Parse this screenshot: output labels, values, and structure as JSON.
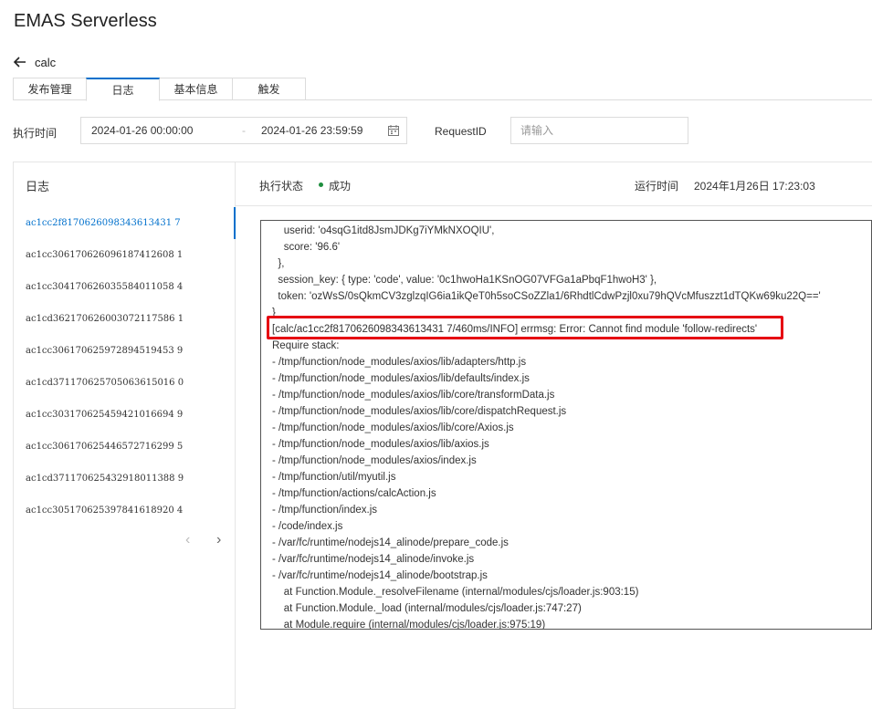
{
  "app": {
    "title": "EMAS Serverless"
  },
  "function": {
    "name": "calc"
  },
  "tabs": [
    {
      "label": "发布管理"
    },
    {
      "label": "日志",
      "active": true
    },
    {
      "label": "基本信息"
    },
    {
      "label": "触发"
    }
  ],
  "filters": {
    "time_label": "执行时间",
    "start": "2024-01-26 00:00:00",
    "separator": "-",
    "end": "2024-01-26 23:59:59",
    "request_label": "RequestID",
    "request_placeholder": "请输入"
  },
  "log_panel": {
    "title": "日志",
    "items": [
      "ac1cc2f8170626098343613431 7",
      "ac1cc306170626096187412608 1",
      "ac1cc304170626035584011058 4",
      "ac1cd362170626003072117586 1",
      "ac1cc306170625972894519453 9",
      "ac1cd371170625705063615016 0",
      "ac1cc303170625459421016694 9",
      "ac1cc306170625446572716299 5",
      "ac1cd371170625432918011388 9",
      "ac1cc305170625397841618920 4"
    ],
    "prev": "‹",
    "next": "›"
  },
  "detail": {
    "status_label": "执行状态",
    "status_value": "成功",
    "run_time_label": "运行时间",
    "run_time_value": "2024年1月26日 17:23:03",
    "status_color": "#1e8e3e",
    "lines": [
      "    userid: 'o4sqG1itd8JsmJDKg7iYMkNXOQIU',",
      "    score: '96.6'",
      "  },",
      "  session_key: { type: 'code', value: '0c1hwoHa1KSnOG07VFGa1aPbqF1hwoH3' },",
      "  token: 'ozWsS/0sQkmCV3zglzqIG6ia1ikQeT0h5soCSoZZla1/6RhdtlCdwPzjl0xu79hQVcMfuszzt1dTQKw69ku22Q=='",
      "}",
      "[calc/ac1cc2f8170626098343613431 7/460ms/INFO] errmsg: Error: Cannot find module 'follow-redirects'",
      "Require stack:",
      "- /tmp/function/node_modules/axios/lib/adapters/http.js",
      "- /tmp/function/node_modules/axios/lib/defaults/index.js",
      "- /tmp/function/node_modules/axios/lib/core/transformData.js",
      "- /tmp/function/node_modules/axios/lib/core/dispatchRequest.js",
      "- /tmp/function/node_modules/axios/lib/core/Axios.js",
      "- /tmp/function/node_modules/axios/lib/axios.js",
      "- /tmp/function/node_modules/axios/index.js",
      "- /tmp/function/util/myutil.js",
      "- /tmp/function/actions/calcAction.js",
      "- /tmp/function/index.js",
      "- /code/index.js",
      "- /var/fc/runtime/nodejs14_alinode/prepare_code.js",
      "- /var/fc/runtime/nodejs14_alinode/invoke.js",
      "- /var/fc/runtime/nodejs14_alinode/bootstrap.js",
      "    at Function.Module._resolveFilename (internal/modules/cjs/loader.js:903:15)",
      "    at Function.Module._load (internal/modules/cjs/loader.js:747:27)",
      "    at Module.require (internal/modules/cjs/loader.js:975:19)"
    ]
  }
}
